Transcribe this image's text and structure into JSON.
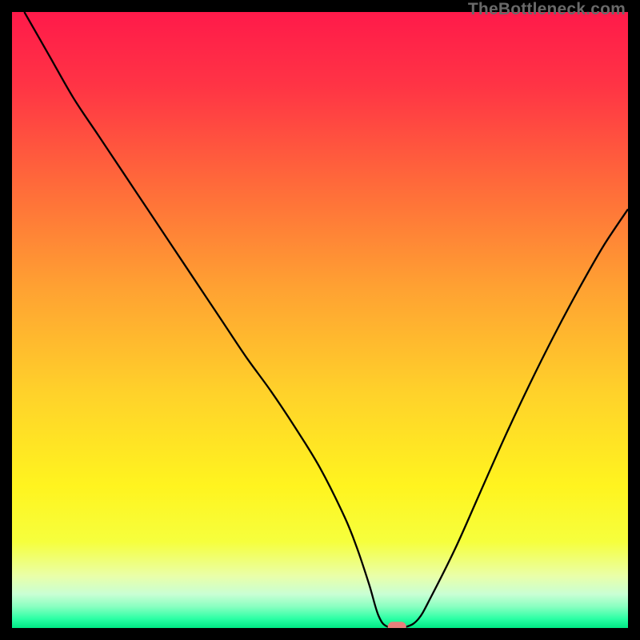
{
  "watermark": "TheBottleneck.com",
  "colors": {
    "curve": "#000000",
    "marker": "#e77f7c",
    "frame": "#000000"
  },
  "gradient_stops": [
    {
      "offset": 0.0,
      "color": "#ff1a4a"
    },
    {
      "offset": 0.12,
      "color": "#ff3445"
    },
    {
      "offset": 0.28,
      "color": "#ff6a3a"
    },
    {
      "offset": 0.45,
      "color": "#ffa232"
    },
    {
      "offset": 0.62,
      "color": "#ffd22a"
    },
    {
      "offset": 0.77,
      "color": "#fff41f"
    },
    {
      "offset": 0.86,
      "color": "#f6ff3d"
    },
    {
      "offset": 0.915,
      "color": "#eaffa8"
    },
    {
      "offset": 0.945,
      "color": "#c9ffd4"
    },
    {
      "offset": 0.965,
      "color": "#8affc1"
    },
    {
      "offset": 0.985,
      "color": "#2bffa5"
    },
    {
      "offset": 1.0,
      "color": "#00e884"
    }
  ],
  "chart_data": {
    "type": "line",
    "title": "",
    "xlabel": "",
    "ylabel": "",
    "xlim": [
      0,
      100
    ],
    "ylim": [
      0,
      100
    ],
    "legend": false,
    "grid": false,
    "series": [
      {
        "name": "bottleneck-curve",
        "x": [
          2,
          6,
          10,
          14,
          18,
          22,
          26,
          30,
          34,
          38,
          42,
          46,
          50,
          54,
          56,
          58,
          59.5,
          61,
          64,
          66,
          68,
          72,
          76,
          80,
          84,
          88,
          92,
          96,
          100
        ],
        "y": [
          100,
          93,
          86,
          80,
          74,
          68,
          62,
          56,
          50,
          44,
          38.5,
          32.5,
          26,
          18,
          13,
          7,
          2,
          0.2,
          0.2,
          1.5,
          5,
          13,
          22,
          31,
          39.5,
          47.5,
          55,
          62,
          68
        ]
      }
    ],
    "marker": {
      "x": 62.5,
      "y": 0.2,
      "w": 3.0,
      "h": 1.6
    },
    "annotations": [
      {
        "text": "TheBottleneck.com",
        "role": "watermark",
        "position": "top-right"
      }
    ]
  }
}
